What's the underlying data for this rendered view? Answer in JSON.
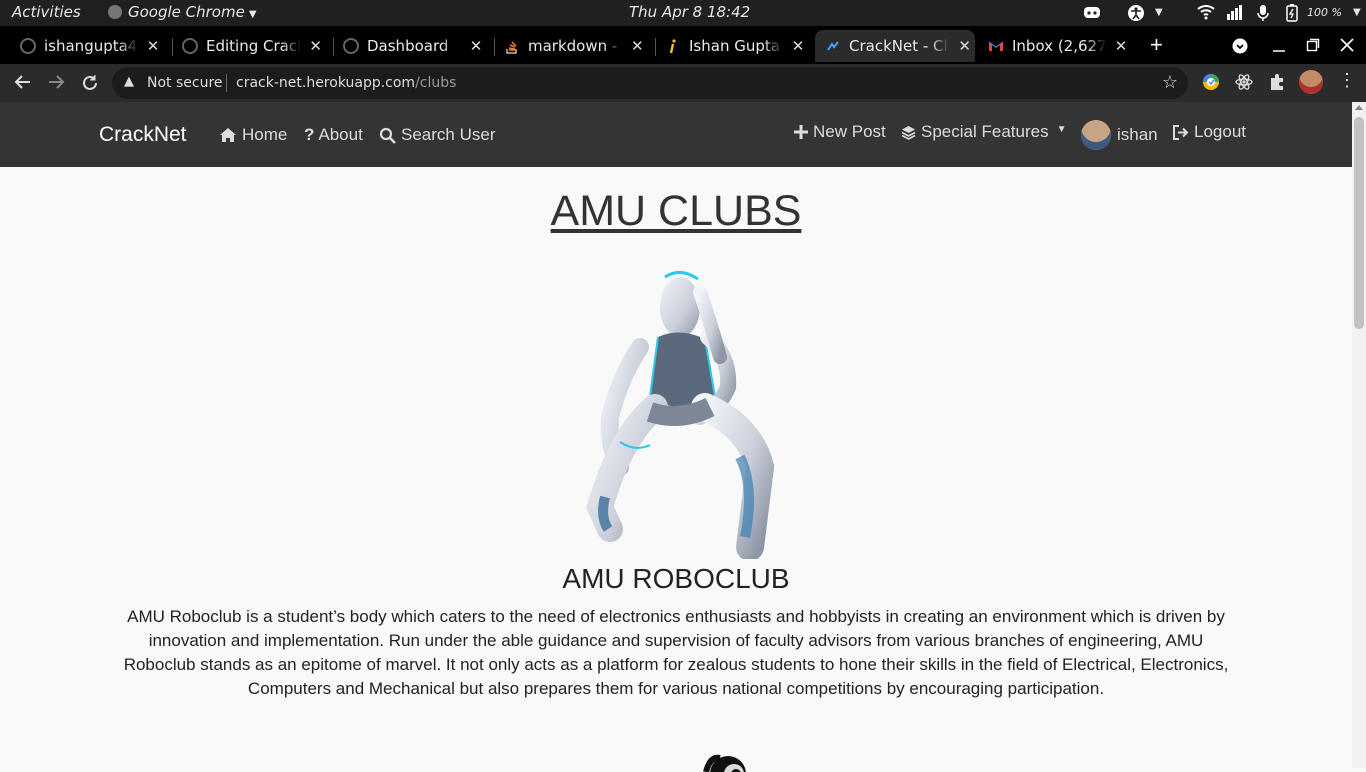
{
  "os_bar": {
    "activities": "Activities",
    "app_name": "Google Chrome",
    "clock": "Thu Apr 8  18:42",
    "battery": "100 %"
  },
  "browser": {
    "tabs": [
      {
        "title": "ishangupta4",
        "favicon": "github-icon"
      },
      {
        "title": "Editing CrackNet",
        "favicon": "github-icon"
      },
      {
        "title": "Dashboard",
        "favicon": "github-icon"
      },
      {
        "title": "markdown - I",
        "favicon": "stackoverflow-icon"
      },
      {
        "title": "Ishan Gupta",
        "favicon": "info-icon"
      },
      {
        "title": "CrackNet - Clubs",
        "favicon": "cracknet-icon",
        "active": true
      },
      {
        "title": "Inbox (2,627",
        "favicon": "gmail-icon"
      }
    ],
    "security_label": "Not secure",
    "url_host": "crack-net.herokuapp.com",
    "url_path": "/clubs"
  },
  "site": {
    "brand": "CrackNet",
    "nav": {
      "home": "Home",
      "about": "About",
      "search_user": "Search User",
      "new_post": "New Post",
      "special_features": "Special Features",
      "username": "ishan",
      "logout": "Logout"
    }
  },
  "page": {
    "heading": "AMU CLUBS",
    "clubs": [
      {
        "name": "AMU ROBOCLUB",
        "description": "AMU Roboclub is a student’s body which caters to the need of electronics enthusiasts and hobbyists in creating an environment which is driven by innovation and implementation. Run under the able guidance and supervision of faculty advisors from various branches of engineering, AMU Roboclub stands as an epitome of marvel. It not only acts as a platform for zealous students to hone their skills in the field of Electrical, Electronics, Computers and Mechanical but also prepares them for various national competitions by encouraging participation."
      }
    ]
  },
  "colors": {
    "navbar_bg": "#343434",
    "page_bg": "#f9f9f9",
    "accent_robot": "#29c8f0"
  }
}
